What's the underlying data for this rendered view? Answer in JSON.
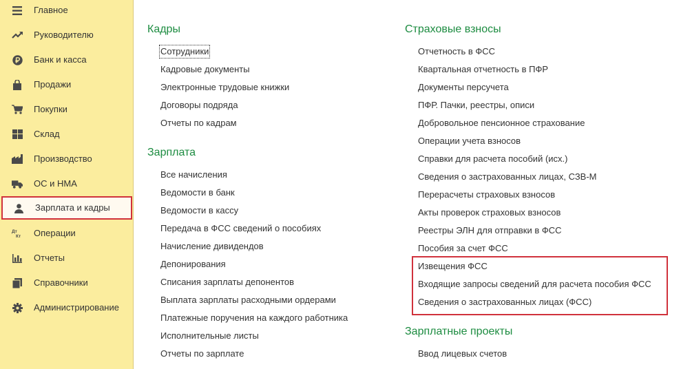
{
  "sidebar": {
    "items": [
      {
        "label": "Главное",
        "icon": "menu-icon"
      },
      {
        "label": "Руководителю",
        "icon": "trend-icon"
      },
      {
        "label": "Банк и касса",
        "icon": "ruble-icon"
      },
      {
        "label": "Продажи",
        "icon": "bag-icon"
      },
      {
        "label": "Покупки",
        "icon": "cart-icon"
      },
      {
        "label": "Склад",
        "icon": "warehouse-icon"
      },
      {
        "label": "Производство",
        "icon": "factory-icon"
      },
      {
        "label": "ОС и НМА",
        "icon": "truck-icon"
      },
      {
        "label": "Зарплата и кадры",
        "icon": "person-icon",
        "active": true
      },
      {
        "label": "Операции",
        "icon": "dt-kt-icon"
      },
      {
        "label": "Отчеты",
        "icon": "bar-chart-icon"
      },
      {
        "label": "Справочники",
        "icon": "books-icon"
      },
      {
        "label": "Администрирование",
        "icon": "gear-icon"
      }
    ],
    "dt_kt_text": {
      "dt": "Дт",
      "kt": "Кт"
    }
  },
  "sections": {
    "kadry": {
      "title": "Кадры",
      "links": [
        "Сотрудники",
        "Кадровые документы",
        "Электронные трудовые книжки",
        "Договоры подряда",
        "Отчеты по кадрам"
      ]
    },
    "zarplata": {
      "title": "Зарплата",
      "links": [
        "Все начисления",
        "Ведомости в банк",
        "Ведомости в кассу",
        "Передача в ФСС сведений о пособиях",
        "Начисление дивидендов",
        "Депонирования",
        "Списания зарплаты депонентов",
        "Выплата зарплаты расходными ордерами",
        "Платежные поручения на каждого работника",
        "Исполнительные листы",
        "Отчеты по зарплате"
      ]
    },
    "strakhovye": {
      "title": "Страховые взносы",
      "links": [
        "Отчетность в ФСС",
        "Квартальная отчетность в ПФР",
        "Документы персучета",
        "ПФР. Пачки, реестры, описи",
        "Добровольное пенсионное страхование",
        "Операции учета взносов",
        "Справки для расчета пособий (исх.)",
        "Сведения о застрахованных лицах, СЗВ-М",
        "Перерасчеты страховых взносов",
        "Акты проверок страховых взносов",
        "Реестры ЭЛН для отправки в ФСС",
        "Пособия за счет ФСС",
        "Извещения ФСС",
        "Входящие запросы сведений для расчета пособия ФСС",
        "Сведения о застрахованных лицах (ФСС)"
      ]
    },
    "zarplatnye": {
      "title": "Зарплатные проекты",
      "links": [
        "Ввод лицевых счетов"
      ]
    }
  },
  "colors": {
    "sidebar_bg": "#fbed9e",
    "section_title": "#1d8c41",
    "highlight": "#d0313b",
    "text": "#333333",
    "icon": "#4a4a4a"
  }
}
